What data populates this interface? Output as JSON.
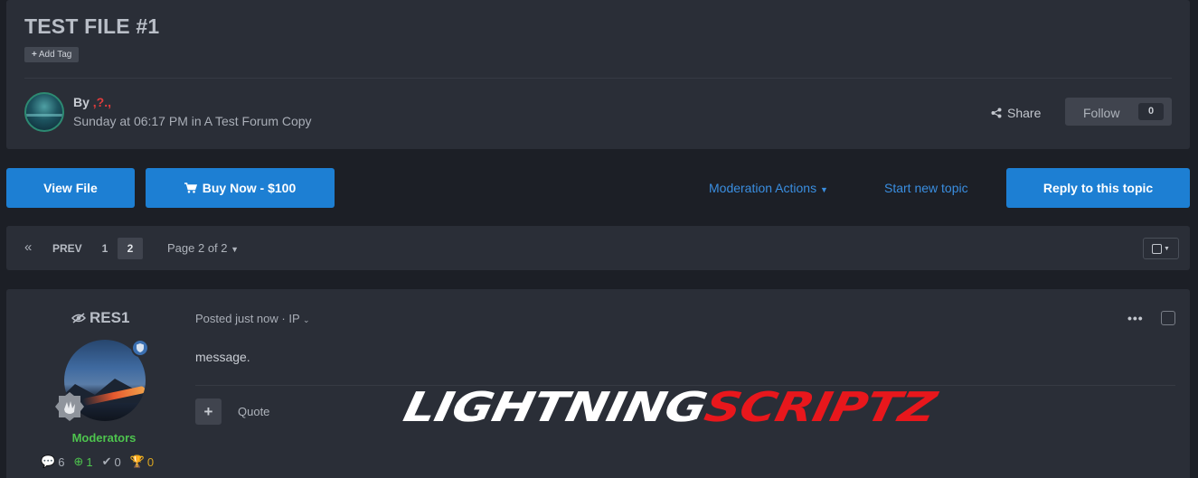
{
  "topic": {
    "title": "TEST FILE #1",
    "add_tag_label": "Add Tag",
    "by_label": "By",
    "author_name": ",?.,",
    "post_meta": "Sunday at 06:17 PM in A Test Forum Copy",
    "share_label": "Share",
    "follow_label": "Follow",
    "follow_count": "0"
  },
  "actions": {
    "view_file": "View File",
    "buy_now": "Buy Now - $100",
    "moderation_actions": "Moderation Actions",
    "start_new_topic": "Start new topic",
    "reply": "Reply to this topic"
  },
  "pagination": {
    "prev_label": "PREV",
    "pages": [
      "1",
      "2"
    ],
    "current_page": "2",
    "jump_label": "Page 2 of 2"
  },
  "post": {
    "author": "RES1",
    "group": "Moderators",
    "stats": {
      "posts": "6",
      "reputation": "1",
      "solutions": "0",
      "achievements": "0"
    },
    "posted_label": "Posted just now · IP",
    "body": "message.",
    "menu_label": "•••",
    "quote_label": "Quote"
  },
  "watermark": {
    "part1": "LIGHTNING",
    "part2": "SCRIPTZ"
  },
  "colors": {
    "accent": "#1d7fd3",
    "link": "#3a8ee0",
    "moderator_group": "#4ec44e",
    "brand_red": "#e8171c",
    "username_red": "#e03c3c"
  }
}
